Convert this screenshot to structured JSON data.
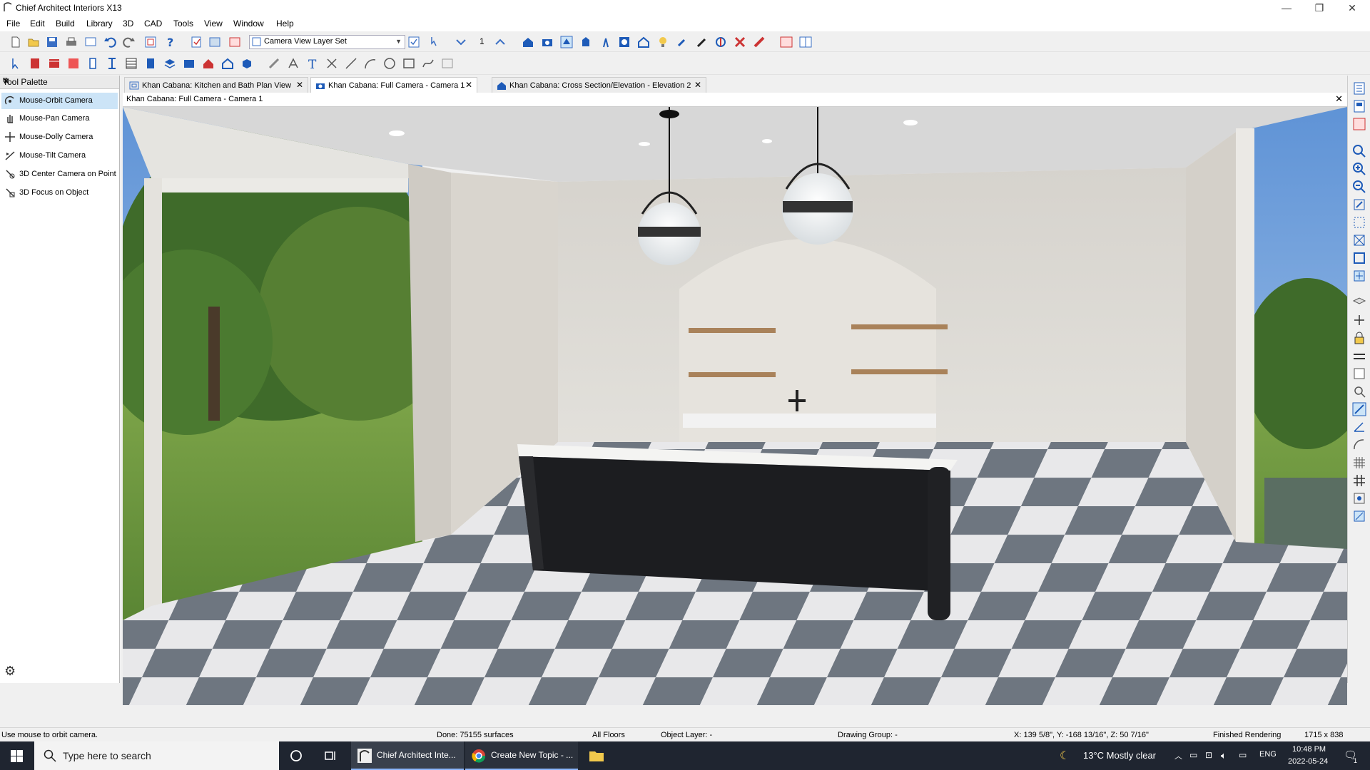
{
  "window": {
    "title": "Chief Architect Interiors X13",
    "minimize": "—",
    "maximize": "❐",
    "close": "✕"
  },
  "menu": [
    "File",
    "Edit",
    "Build",
    "Library",
    "3D",
    "CAD",
    "Tools",
    "View",
    "Window",
    "Help"
  ],
  "toolbar": {
    "layer_set": "Camera View Layer Set",
    "floor_number": "1"
  },
  "palette": {
    "title": "Tool Palette",
    "items": [
      {
        "label": "Mouse-Orbit Camera",
        "icon": "orbit-camera-icon",
        "selected": true
      },
      {
        "label": "Mouse-Pan Camera",
        "icon": "pan-hand-icon",
        "selected": false
      },
      {
        "label": "Mouse-Dolly Camera",
        "icon": "dolly-camera-icon",
        "selected": false
      },
      {
        "label": "Mouse-Tilt Camera",
        "icon": "tilt-camera-icon",
        "selected": false
      },
      {
        "label": "3D Center Camera on Point",
        "icon": "center-camera-icon",
        "selected": false
      },
      {
        "label": "3D Focus on Object",
        "icon": "focus-object-icon",
        "selected": false
      }
    ]
  },
  "tabs": [
    {
      "label": "Khan Cabana: Kitchen and Bath Plan View",
      "icon": "plan-view-icon",
      "active": false
    },
    {
      "label": "Khan Cabana: Full Camera - Camera 1",
      "icon": "camera-icon",
      "active": true
    },
    {
      "label": "Khan Cabana: Cross Section/Elevation - Elevation 2",
      "icon": "elevation-icon",
      "active": false
    }
  ],
  "view_title": "Khan Cabana: Full Camera - Camera 1",
  "status": {
    "hint": "Use mouse to orbit camera.",
    "done": "Done:  75155 surfaces",
    "floors": "All Floors",
    "object_layer": "Object Layer: -",
    "drawing_group": "Drawing Group: -",
    "coords": "X: 139 5/8\", Y: -168 13/16\", Z: 50 7/16\"",
    "render": "Finished Rendering",
    "size": "1715 x 838"
  },
  "taskbar": {
    "search_placeholder": "Type here to search",
    "apps": [
      {
        "label": "Chief Architect Inte...",
        "icon": "chief-architect-icon"
      },
      {
        "label": "Create New Topic - ...",
        "icon": "chrome-icon"
      }
    ],
    "weather": "13°C  Mostly clear",
    "lang": "ENG",
    "time": "10:48 PM",
    "date": "2022-05-24",
    "notif_count": "1"
  },
  "colors": {
    "accent": "#0078d7",
    "selected": "#cce4f7",
    "taskbar": "#1f2530"
  }
}
